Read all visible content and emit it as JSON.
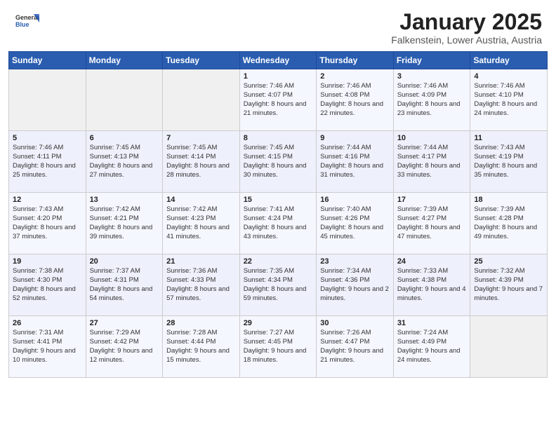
{
  "header": {
    "logo_general": "General",
    "logo_blue": "Blue",
    "month": "January 2025",
    "location": "Falkenstein, Lower Austria, Austria"
  },
  "weekdays": [
    "Sunday",
    "Monday",
    "Tuesday",
    "Wednesday",
    "Thursday",
    "Friday",
    "Saturday"
  ],
  "weeks": [
    [
      {
        "day": "",
        "content": ""
      },
      {
        "day": "",
        "content": ""
      },
      {
        "day": "",
        "content": ""
      },
      {
        "day": "1",
        "content": "Sunrise: 7:46 AM\nSunset: 4:07 PM\nDaylight: 8 hours and 21 minutes."
      },
      {
        "day": "2",
        "content": "Sunrise: 7:46 AM\nSunset: 4:08 PM\nDaylight: 8 hours and 22 minutes."
      },
      {
        "day": "3",
        "content": "Sunrise: 7:46 AM\nSunset: 4:09 PM\nDaylight: 8 hours and 23 minutes."
      },
      {
        "day": "4",
        "content": "Sunrise: 7:46 AM\nSunset: 4:10 PM\nDaylight: 8 hours and 24 minutes."
      }
    ],
    [
      {
        "day": "5",
        "content": "Sunrise: 7:46 AM\nSunset: 4:11 PM\nDaylight: 8 hours and 25 minutes."
      },
      {
        "day": "6",
        "content": "Sunrise: 7:45 AM\nSunset: 4:13 PM\nDaylight: 8 hours and 27 minutes."
      },
      {
        "day": "7",
        "content": "Sunrise: 7:45 AM\nSunset: 4:14 PM\nDaylight: 8 hours and 28 minutes."
      },
      {
        "day": "8",
        "content": "Sunrise: 7:45 AM\nSunset: 4:15 PM\nDaylight: 8 hours and 30 minutes."
      },
      {
        "day": "9",
        "content": "Sunrise: 7:44 AM\nSunset: 4:16 PM\nDaylight: 8 hours and 31 minutes."
      },
      {
        "day": "10",
        "content": "Sunrise: 7:44 AM\nSunset: 4:17 PM\nDaylight: 8 hours and 33 minutes."
      },
      {
        "day": "11",
        "content": "Sunrise: 7:43 AM\nSunset: 4:19 PM\nDaylight: 8 hours and 35 minutes."
      }
    ],
    [
      {
        "day": "12",
        "content": "Sunrise: 7:43 AM\nSunset: 4:20 PM\nDaylight: 8 hours and 37 minutes."
      },
      {
        "day": "13",
        "content": "Sunrise: 7:42 AM\nSunset: 4:21 PM\nDaylight: 8 hours and 39 minutes."
      },
      {
        "day": "14",
        "content": "Sunrise: 7:42 AM\nSunset: 4:23 PM\nDaylight: 8 hours and 41 minutes."
      },
      {
        "day": "15",
        "content": "Sunrise: 7:41 AM\nSunset: 4:24 PM\nDaylight: 8 hours and 43 minutes."
      },
      {
        "day": "16",
        "content": "Sunrise: 7:40 AM\nSunset: 4:26 PM\nDaylight: 8 hours and 45 minutes."
      },
      {
        "day": "17",
        "content": "Sunrise: 7:39 AM\nSunset: 4:27 PM\nDaylight: 8 hours and 47 minutes."
      },
      {
        "day": "18",
        "content": "Sunrise: 7:39 AM\nSunset: 4:28 PM\nDaylight: 8 hours and 49 minutes."
      }
    ],
    [
      {
        "day": "19",
        "content": "Sunrise: 7:38 AM\nSunset: 4:30 PM\nDaylight: 8 hours and 52 minutes."
      },
      {
        "day": "20",
        "content": "Sunrise: 7:37 AM\nSunset: 4:31 PM\nDaylight: 8 hours and 54 minutes."
      },
      {
        "day": "21",
        "content": "Sunrise: 7:36 AM\nSunset: 4:33 PM\nDaylight: 8 hours and 57 minutes."
      },
      {
        "day": "22",
        "content": "Sunrise: 7:35 AM\nSunset: 4:34 PM\nDaylight: 8 hours and 59 minutes."
      },
      {
        "day": "23",
        "content": "Sunrise: 7:34 AM\nSunset: 4:36 PM\nDaylight: 9 hours and 2 minutes."
      },
      {
        "day": "24",
        "content": "Sunrise: 7:33 AM\nSunset: 4:38 PM\nDaylight: 9 hours and 4 minutes."
      },
      {
        "day": "25",
        "content": "Sunrise: 7:32 AM\nSunset: 4:39 PM\nDaylight: 9 hours and 7 minutes."
      }
    ],
    [
      {
        "day": "26",
        "content": "Sunrise: 7:31 AM\nSunset: 4:41 PM\nDaylight: 9 hours and 10 minutes."
      },
      {
        "day": "27",
        "content": "Sunrise: 7:29 AM\nSunset: 4:42 PM\nDaylight: 9 hours and 12 minutes."
      },
      {
        "day": "28",
        "content": "Sunrise: 7:28 AM\nSunset: 4:44 PM\nDaylight: 9 hours and 15 minutes."
      },
      {
        "day": "29",
        "content": "Sunrise: 7:27 AM\nSunset: 4:45 PM\nDaylight: 9 hours and 18 minutes."
      },
      {
        "day": "30",
        "content": "Sunrise: 7:26 AM\nSunset: 4:47 PM\nDaylight: 9 hours and 21 minutes."
      },
      {
        "day": "31",
        "content": "Sunrise: 7:24 AM\nSunset: 4:49 PM\nDaylight: 9 hours and 24 minutes."
      },
      {
        "day": "",
        "content": ""
      }
    ]
  ]
}
